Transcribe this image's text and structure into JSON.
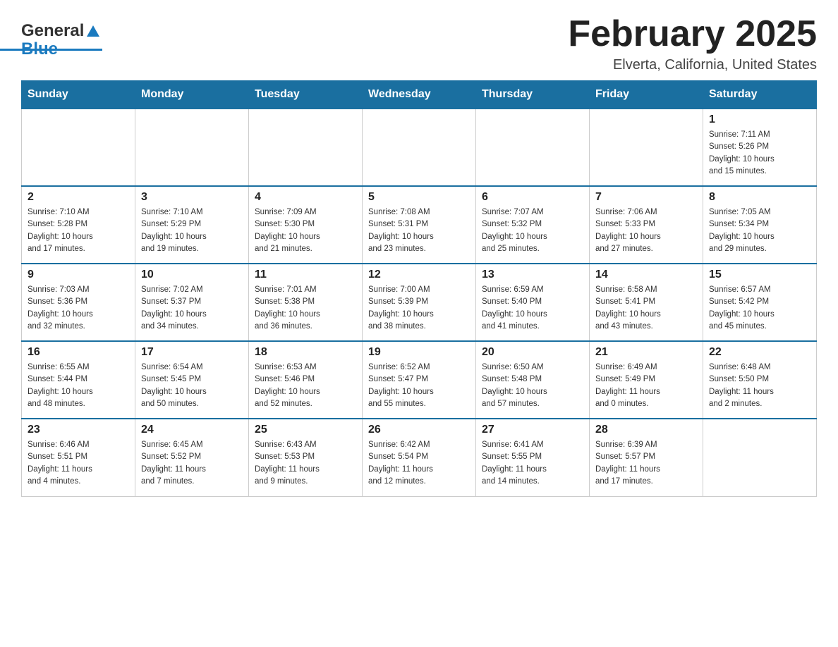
{
  "header": {
    "logo_general": "General",
    "logo_blue": "Blue",
    "month_title": "February 2025",
    "location": "Elverta, California, United States"
  },
  "days_of_week": [
    "Sunday",
    "Monday",
    "Tuesday",
    "Wednesday",
    "Thursday",
    "Friday",
    "Saturday"
  ],
  "weeks": [
    [
      {
        "day": "",
        "info": ""
      },
      {
        "day": "",
        "info": ""
      },
      {
        "day": "",
        "info": ""
      },
      {
        "day": "",
        "info": ""
      },
      {
        "day": "",
        "info": ""
      },
      {
        "day": "",
        "info": ""
      },
      {
        "day": "1",
        "info": "Sunrise: 7:11 AM\nSunset: 5:26 PM\nDaylight: 10 hours\nand 15 minutes."
      }
    ],
    [
      {
        "day": "2",
        "info": "Sunrise: 7:10 AM\nSunset: 5:28 PM\nDaylight: 10 hours\nand 17 minutes."
      },
      {
        "day": "3",
        "info": "Sunrise: 7:10 AM\nSunset: 5:29 PM\nDaylight: 10 hours\nand 19 minutes."
      },
      {
        "day": "4",
        "info": "Sunrise: 7:09 AM\nSunset: 5:30 PM\nDaylight: 10 hours\nand 21 minutes."
      },
      {
        "day": "5",
        "info": "Sunrise: 7:08 AM\nSunset: 5:31 PM\nDaylight: 10 hours\nand 23 minutes."
      },
      {
        "day": "6",
        "info": "Sunrise: 7:07 AM\nSunset: 5:32 PM\nDaylight: 10 hours\nand 25 minutes."
      },
      {
        "day": "7",
        "info": "Sunrise: 7:06 AM\nSunset: 5:33 PM\nDaylight: 10 hours\nand 27 minutes."
      },
      {
        "day": "8",
        "info": "Sunrise: 7:05 AM\nSunset: 5:34 PM\nDaylight: 10 hours\nand 29 minutes."
      }
    ],
    [
      {
        "day": "9",
        "info": "Sunrise: 7:03 AM\nSunset: 5:36 PM\nDaylight: 10 hours\nand 32 minutes."
      },
      {
        "day": "10",
        "info": "Sunrise: 7:02 AM\nSunset: 5:37 PM\nDaylight: 10 hours\nand 34 minutes."
      },
      {
        "day": "11",
        "info": "Sunrise: 7:01 AM\nSunset: 5:38 PM\nDaylight: 10 hours\nand 36 minutes."
      },
      {
        "day": "12",
        "info": "Sunrise: 7:00 AM\nSunset: 5:39 PM\nDaylight: 10 hours\nand 38 minutes."
      },
      {
        "day": "13",
        "info": "Sunrise: 6:59 AM\nSunset: 5:40 PM\nDaylight: 10 hours\nand 41 minutes."
      },
      {
        "day": "14",
        "info": "Sunrise: 6:58 AM\nSunset: 5:41 PM\nDaylight: 10 hours\nand 43 minutes."
      },
      {
        "day": "15",
        "info": "Sunrise: 6:57 AM\nSunset: 5:42 PM\nDaylight: 10 hours\nand 45 minutes."
      }
    ],
    [
      {
        "day": "16",
        "info": "Sunrise: 6:55 AM\nSunset: 5:44 PM\nDaylight: 10 hours\nand 48 minutes."
      },
      {
        "day": "17",
        "info": "Sunrise: 6:54 AM\nSunset: 5:45 PM\nDaylight: 10 hours\nand 50 minutes."
      },
      {
        "day": "18",
        "info": "Sunrise: 6:53 AM\nSunset: 5:46 PM\nDaylight: 10 hours\nand 52 minutes."
      },
      {
        "day": "19",
        "info": "Sunrise: 6:52 AM\nSunset: 5:47 PM\nDaylight: 10 hours\nand 55 minutes."
      },
      {
        "day": "20",
        "info": "Sunrise: 6:50 AM\nSunset: 5:48 PM\nDaylight: 10 hours\nand 57 minutes."
      },
      {
        "day": "21",
        "info": "Sunrise: 6:49 AM\nSunset: 5:49 PM\nDaylight: 11 hours\nand 0 minutes."
      },
      {
        "day": "22",
        "info": "Sunrise: 6:48 AM\nSunset: 5:50 PM\nDaylight: 11 hours\nand 2 minutes."
      }
    ],
    [
      {
        "day": "23",
        "info": "Sunrise: 6:46 AM\nSunset: 5:51 PM\nDaylight: 11 hours\nand 4 minutes."
      },
      {
        "day": "24",
        "info": "Sunrise: 6:45 AM\nSunset: 5:52 PM\nDaylight: 11 hours\nand 7 minutes."
      },
      {
        "day": "25",
        "info": "Sunrise: 6:43 AM\nSunset: 5:53 PM\nDaylight: 11 hours\nand 9 minutes."
      },
      {
        "day": "26",
        "info": "Sunrise: 6:42 AM\nSunset: 5:54 PM\nDaylight: 11 hours\nand 12 minutes."
      },
      {
        "day": "27",
        "info": "Sunrise: 6:41 AM\nSunset: 5:55 PM\nDaylight: 11 hours\nand 14 minutes."
      },
      {
        "day": "28",
        "info": "Sunrise: 6:39 AM\nSunset: 5:57 PM\nDaylight: 11 hours\nand 17 minutes."
      },
      {
        "day": "",
        "info": ""
      }
    ]
  ]
}
